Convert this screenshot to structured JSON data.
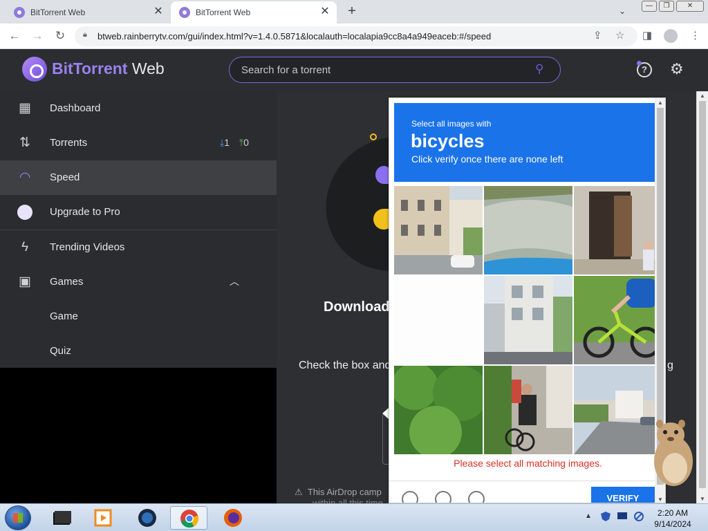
{
  "browser": {
    "tabs": [
      {
        "title": "BitTorrent Web"
      },
      {
        "title": "BitTorrent Web"
      }
    ],
    "new_tab_label": "+",
    "url": "btweb.rainberrytv.com/gui/index.html?v=1.4.0.5871&localauth=localapia9cc8a4a949eaceb:#/speed"
  },
  "app": {
    "brand": "BitTorrent",
    "brand_suffix": "Web",
    "search_placeholder": "Search for a torrent"
  },
  "sidebar": {
    "items": [
      {
        "label": "Dashboard",
        "icon": "dashboard-icon"
      },
      {
        "label": "Torrents",
        "icon": "transfer-arrows-icon",
        "down_count": "1",
        "up_count": "0"
      },
      {
        "label": "Speed",
        "icon": "speedometer-icon",
        "active": true
      },
      {
        "label": "Upgrade to Pro",
        "icon": "bittorrent-logo-icon"
      },
      {
        "label": "Trending Videos",
        "icon": "lightning-video-icon"
      },
      {
        "label": "Games",
        "icon": "gamepad-icon",
        "expanded": true
      },
      {
        "label": "Game"
      },
      {
        "label": "Quiz"
      }
    ]
  },
  "main": {
    "title_partial": "Download",
    "body_partial": "Check the box and",
    "body_tail": "g",
    "notice_partial": "This AirDrop camp",
    "notice_line2": "within all this time"
  },
  "captcha": {
    "prompt_small": "Select all images with",
    "prompt_big": "bicycles",
    "prompt_instruction": "Click verify once there are none left",
    "error": "Please select all matching images.",
    "verify_label": "VERIFY",
    "tiles": [
      "street-building",
      "water-boat",
      "doorway-man",
      "blank",
      "apartment-building",
      "cyclist-road",
      "tree-foliage",
      "man-bicycle-sidewalk",
      "street-intersection"
    ]
  },
  "taskbar": {
    "time": "2:20 AM",
    "date": "9/14/2024"
  },
  "colors": {
    "accent": "#8a70f0",
    "captcha_blue": "#1a73e8",
    "error_red": "#d93025",
    "sidebar_bg": "#2b2c2f"
  }
}
